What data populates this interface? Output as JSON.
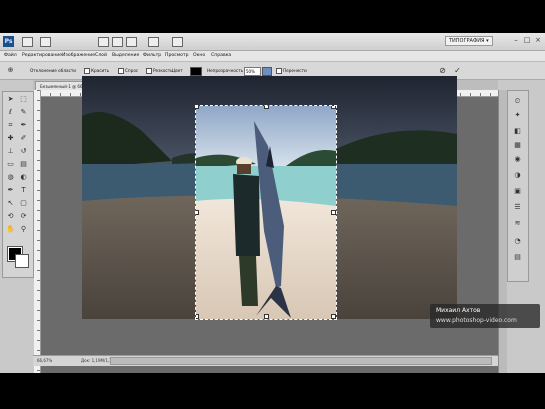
{
  "app": {
    "logo": "Ps",
    "workspace": "ТИПОГРАФИЯ ▾",
    "window_controls": [
      "–",
      "□",
      "×"
    ]
  },
  "menu": [
    "Файл",
    "Редактирование",
    "Изображение",
    "Слой",
    "Выделение",
    "Фильтр",
    "Просмотр",
    "Окно",
    "Справка"
  ],
  "options": {
    "lbl1": "Отклонение области",
    "chk1": "Красить",
    "chk2": "Спрос",
    "chk3": "Резкость",
    "lbl2": "Цвет",
    "lbl3": "Непрозрачность",
    "opacity": "50%",
    "chk4": "Перенести",
    "commit_icon": "check-icon",
    "cancel_icon": "cancel-icon"
  },
  "tabs": [
    {
      "label": "Безымянный-1 @ 66,7% (Слой 1, RGB/8) ×",
      "active": true
    },
    {
      "label": "Безымянный-2 @ 66,7% ×",
      "active": false
    }
  ],
  "watermark": {
    "line1": "Михаил Ахтов",
    "line2": "www.photoshop-video.com"
  },
  "status": {
    "zoom": "66,67%",
    "doc": "Док: 1,19M/1,36M"
  },
  "colors": {
    "sky": "#2e3340",
    "sea": "#41607a",
    "sand": "#8e8273",
    "selection_sky": "#b9cbe0",
    "selection_sea": "#78c2c6",
    "selection_sand": "#e8ddd0"
  }
}
